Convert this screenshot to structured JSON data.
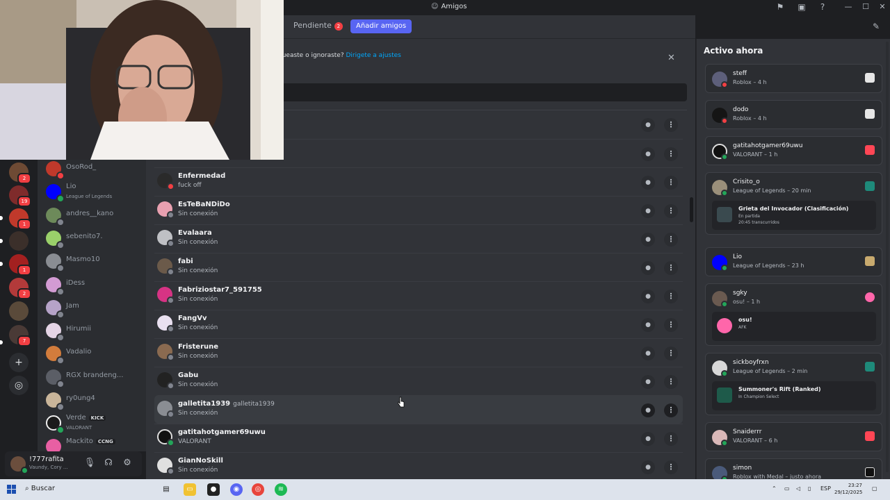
{
  "window": {
    "title": "Amigos"
  },
  "tabs": {
    "pending_label": "Pendiente",
    "pending_count": "2",
    "add_friend_label": "Añadir amigos"
  },
  "banner": {
    "text": "queaste o ignoraste?",
    "link": "Dirigete a ajustes"
  },
  "server_badges": [
    "2",
    "19",
    "1",
    "1",
    "2",
    "7"
  ],
  "dms": [
    {
      "name": "OsoRod_",
      "sub": ""
    },
    {
      "name": "Lio",
      "sub": "League of Legends"
    },
    {
      "name": "andres__kano",
      "sub": ""
    },
    {
      "name": "sebenito7.",
      "sub": ""
    },
    {
      "name": "Masmo10",
      "sub": ""
    },
    {
      "name": "iDess",
      "sub": ""
    },
    {
      "name": "Jam",
      "sub": ""
    },
    {
      "name": "Hirumii",
      "sub": ""
    },
    {
      "name": "Vadalio",
      "sub": ""
    },
    {
      "name": "RGX brandeng...",
      "sub": ""
    },
    {
      "name": "ry0ung4",
      "sub": ""
    },
    {
      "name": "Verde",
      "tag": "KICK",
      "sub": "VALORANT"
    },
    {
      "name": "Mackito",
      "tag": "CCNG",
      "sub": ""
    }
  ],
  "user": {
    "name": "!777rafita",
    "sub": "Vaundy, Cory ..."
  },
  "friends": [
    {
      "name": "Enfermedad",
      "sub": "fuck off"
    },
    {
      "name": "EsTeBaNDiDo",
      "sub": "Sin conexión"
    },
    {
      "name": "Evalaara",
      "sub": "Sin conexión"
    },
    {
      "name": "fabi",
      "sub": "Sin conexión"
    },
    {
      "name": "Fabriziostar7_591755",
      "sub": "Sin conexión"
    },
    {
      "name": "FangVv",
      "sub": "Sin conexión"
    },
    {
      "name": "Fristerune",
      "sub": "Sin conexión"
    },
    {
      "name": "Gabu",
      "sub": "Sin conexión"
    },
    {
      "name": "galletita1939",
      "username": "galletita1939",
      "sub": "Sin conexión"
    },
    {
      "name": "gatitahotgamer69uwu",
      "sub": "VALORANT"
    },
    {
      "name": "GianNoSkill",
      "sub": "Sin conexión"
    }
  ],
  "active_now": {
    "title": "Activo ahora",
    "cards": [
      {
        "name": "steff",
        "sub": "Roblox – 4 h"
      },
      {
        "name": "dodo",
        "sub": "Roblox – 4 h"
      },
      {
        "name": "gatitahotgamer69uwu",
        "sub": "VALORANT – 1 h"
      },
      {
        "name": "Crisito_o",
        "sub": "League of Legends – 20 min",
        "detail": {
          "title": "Grieta del Invocador (Clasificación)",
          "line1": "En partida",
          "line2": "20:45 transcurridos"
        }
      },
      {
        "name": "Lio",
        "sub": "League of Legends – 23 h"
      },
      {
        "name": "sgky",
        "sub": "osu! – 1 h",
        "detail": {
          "title": "osu!",
          "line1": "AFK",
          "line2": ""
        }
      },
      {
        "name": "sickboyfrxn",
        "sub": "League of Legends – 2 min",
        "detail": {
          "title": "Summoner's Rift (Ranked)",
          "line1": "In Champion Select",
          "line2": ""
        }
      },
      {
        "name": "Snaiderrr",
        "sub": "VALORANT – 6 h"
      },
      {
        "name": "simon",
        "sub": "Roblox with Medal – justo ahora"
      }
    ]
  },
  "taskbar": {
    "search": "Buscar",
    "lang": "ESP",
    "time": "23:27",
    "date": "29/12/2025"
  },
  "colors": {
    "accent": "#5865f2",
    "online": "#23a559",
    "idle": "#f0b232",
    "dnd": "#f23f43",
    "offline": "#80848e"
  }
}
